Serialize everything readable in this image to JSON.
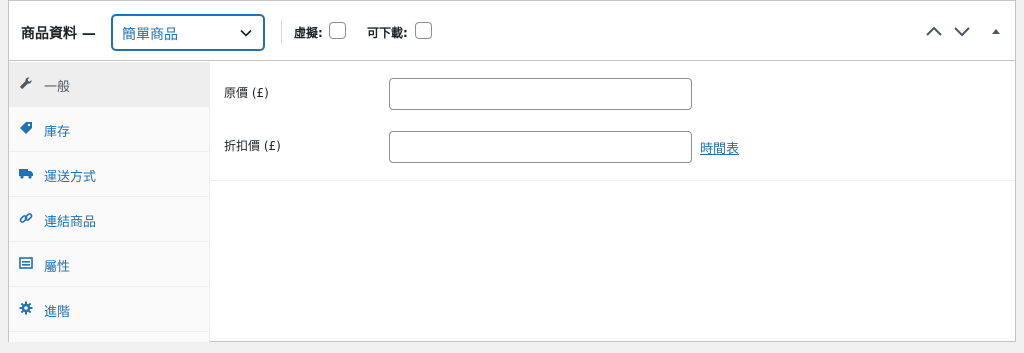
{
  "header": {
    "title": "商品資料 —",
    "product_type": "簡單商品",
    "virtual_label": "虛擬:",
    "downloadable_label": "可下載:"
  },
  "tabs": [
    {
      "label": "一般",
      "icon": "wrench-icon",
      "active": true
    },
    {
      "label": "庫存",
      "icon": "tag-icon",
      "active": false
    },
    {
      "label": "運送方式",
      "icon": "truck-icon",
      "active": false
    },
    {
      "label": "連結商品",
      "icon": "link-icon",
      "active": false
    },
    {
      "label": "屬性",
      "icon": "list-icon",
      "active": false
    },
    {
      "label": "進階",
      "icon": "gear-icon",
      "active": false
    }
  ],
  "general": {
    "regular_price_label": "原價 (£)",
    "regular_price_value": "",
    "sale_price_label": "折扣價 (£)",
    "sale_price_value": "",
    "schedule_link": "時間表"
  },
  "colors": {
    "accent": "#2271b1",
    "border": "#c3c4c7"
  }
}
